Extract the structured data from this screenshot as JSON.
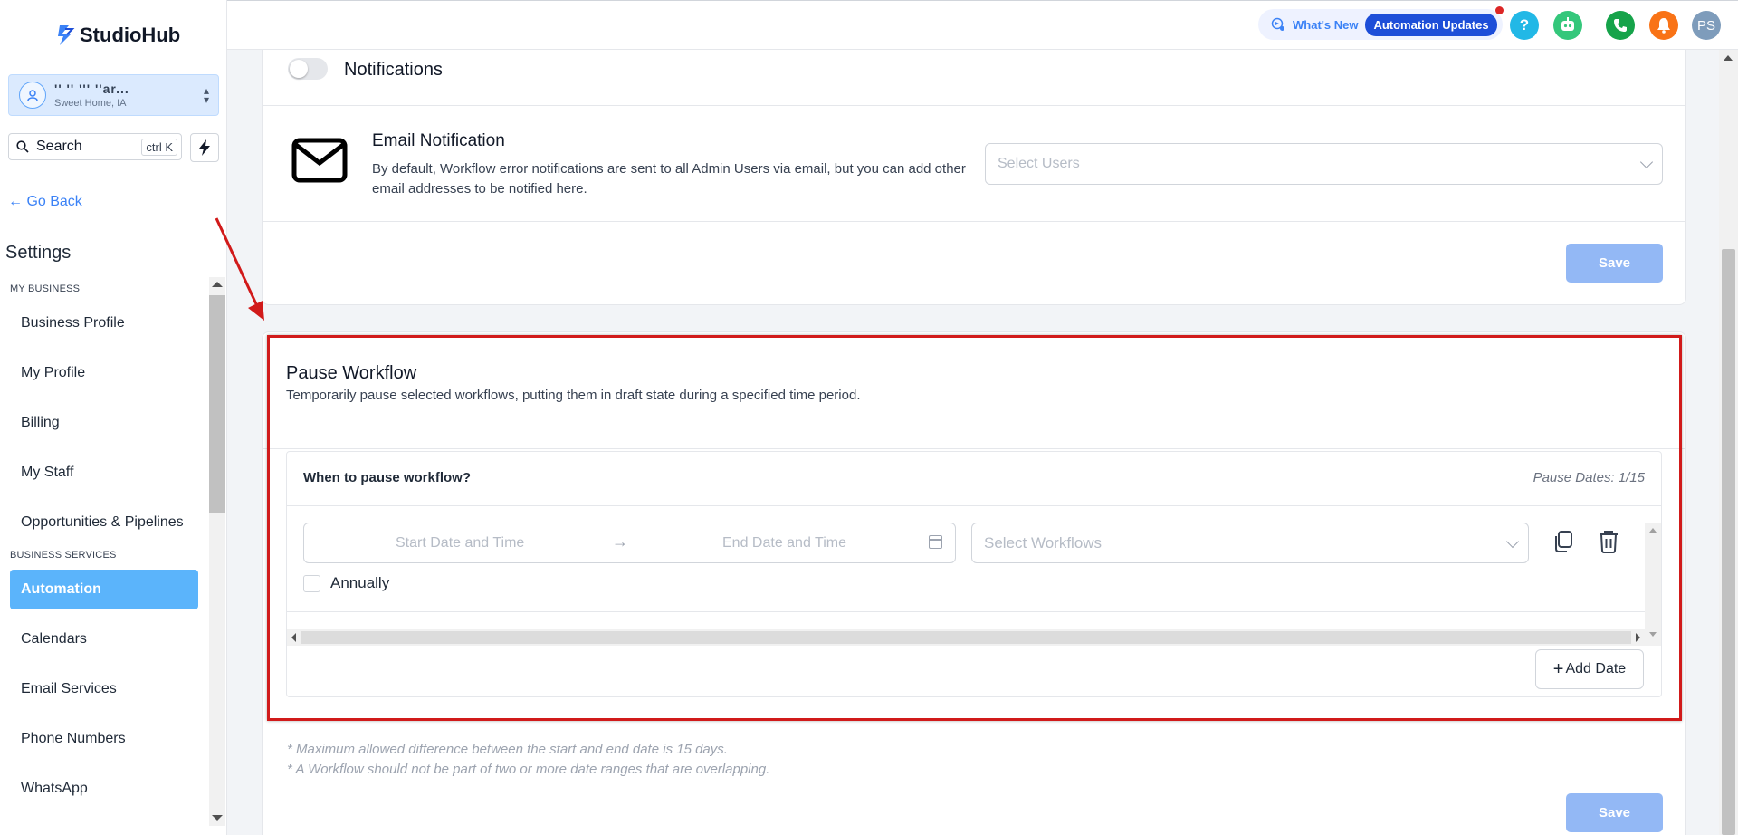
{
  "brand": {
    "name": "StudioHub"
  },
  "location": {
    "name": "'' '' ''' ''ar...",
    "subtitle": "Sweet Home, IA"
  },
  "search": {
    "label": "Search",
    "shortcut": "ctrl K"
  },
  "nav": {
    "go_back": "← Go Back",
    "title": "Settings",
    "sections": [
      {
        "label": "MY BUSINESS",
        "items": [
          "Business Profile",
          "My Profile",
          "Billing",
          "My Staff",
          "Opportunities & Pipelines"
        ]
      },
      {
        "label": "BUSINESS SERVICES",
        "items": [
          "Automation",
          "Calendars",
          "Email Services",
          "Phone Numbers",
          "WhatsApp"
        ]
      }
    ],
    "active_item": "Automation"
  },
  "header": {
    "whats_new": "What's New",
    "automation_updates": "Automation Updates",
    "help_label": "?",
    "avatar_initials": "PS"
  },
  "notifications": {
    "toggle_label": "Notifications",
    "toggle_on": false,
    "email_title": "Email Notification",
    "email_desc": "By default, Workflow error notifications are sent to all Admin Users via email, but you can add other email addresses to be notified here.",
    "select_placeholder": "Select Users",
    "save_label": "Save"
  },
  "pause": {
    "title": "Pause Workflow",
    "description": "Temporarily pause selected workflows, putting them in draft state during a specified time period.",
    "when_label": "When to pause workflow?",
    "dates_count": "Pause Dates: 1/15",
    "start_placeholder": "Start Date and Time",
    "end_placeholder": "End Date and Time",
    "workflows_placeholder": "Select Workflows",
    "annually_label": "Annually",
    "add_date_label": "Add Date",
    "notes": [
      "* Maximum allowed difference between the start and end date is 15 days.",
      "* A Workflow should not be part of two or more date ranges that are overlapping."
    ],
    "save_label": "Save"
  },
  "colors": {
    "accent": "#5bb4fb",
    "save_button": "#93b8f5",
    "highlight_box": "#d11a1a",
    "brand_blue": "#1d4ed8"
  }
}
